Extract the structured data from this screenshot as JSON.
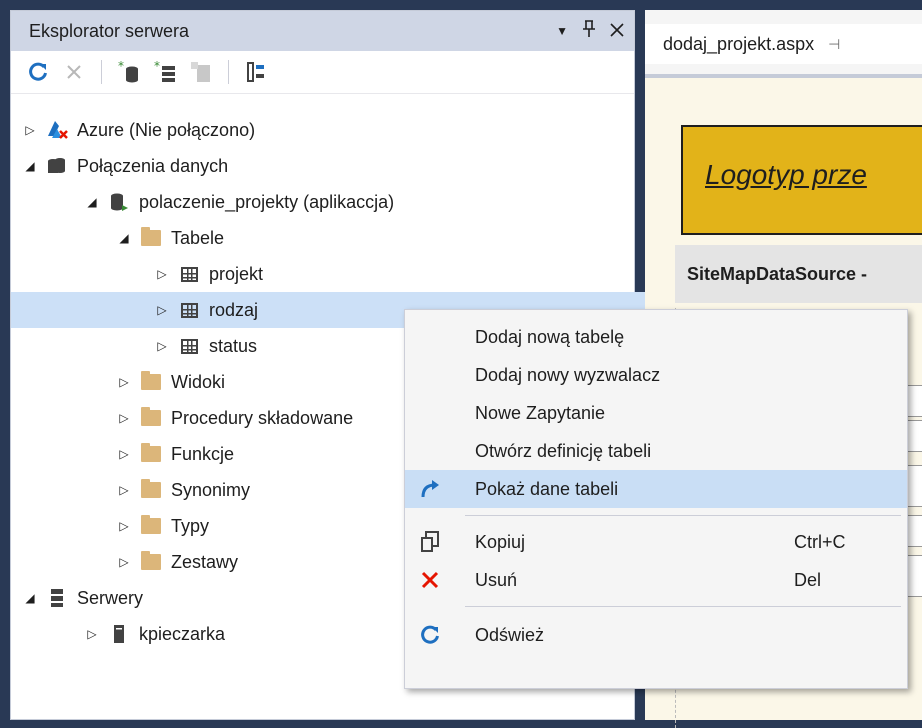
{
  "explorer": {
    "title": "Eksplorator serwera",
    "tree": [
      {
        "label": "Azure (Nie połączono)"
      },
      {
        "label": "Połączenia danych"
      },
      {
        "label": "polaczenie_projekty (aplikaccja)"
      },
      {
        "label": "Tabele"
      },
      {
        "label": "projekt"
      },
      {
        "label": "rodzaj"
      },
      {
        "label": "status"
      },
      {
        "label": "Widoki"
      },
      {
        "label": "Procedury składowane"
      },
      {
        "label": "Funkcje"
      },
      {
        "label": "Synonimy"
      },
      {
        "label": "Typy"
      },
      {
        "label": "Zestawy"
      },
      {
        "label": "Serwery"
      },
      {
        "label": "kpieczarka"
      }
    ]
  },
  "designer": {
    "tab_label": "dodaj_projekt.aspx",
    "logo_text": "Logotyp prze",
    "sitemap_label": "SiteMapDataSource -"
  },
  "context_menu": {
    "items": [
      {
        "label": "Dodaj nową tabelę"
      },
      {
        "label": "Dodaj nowy wyzwalacz"
      },
      {
        "label": "Nowe Zapytanie"
      },
      {
        "label": "Otwórz definicję tabeli"
      },
      {
        "label": "Pokaż dane tabeli"
      },
      {
        "label": "Kopiuj",
        "shortcut": "Ctrl+C"
      },
      {
        "label": "Usuń",
        "shortcut": "Del"
      },
      {
        "label": "Odśwież"
      }
    ]
  },
  "colors": {
    "selection": "#cce0f7",
    "menu_highlight": "#c9def5",
    "accent": "#1e6fc0",
    "delete_red": "#e51400"
  }
}
